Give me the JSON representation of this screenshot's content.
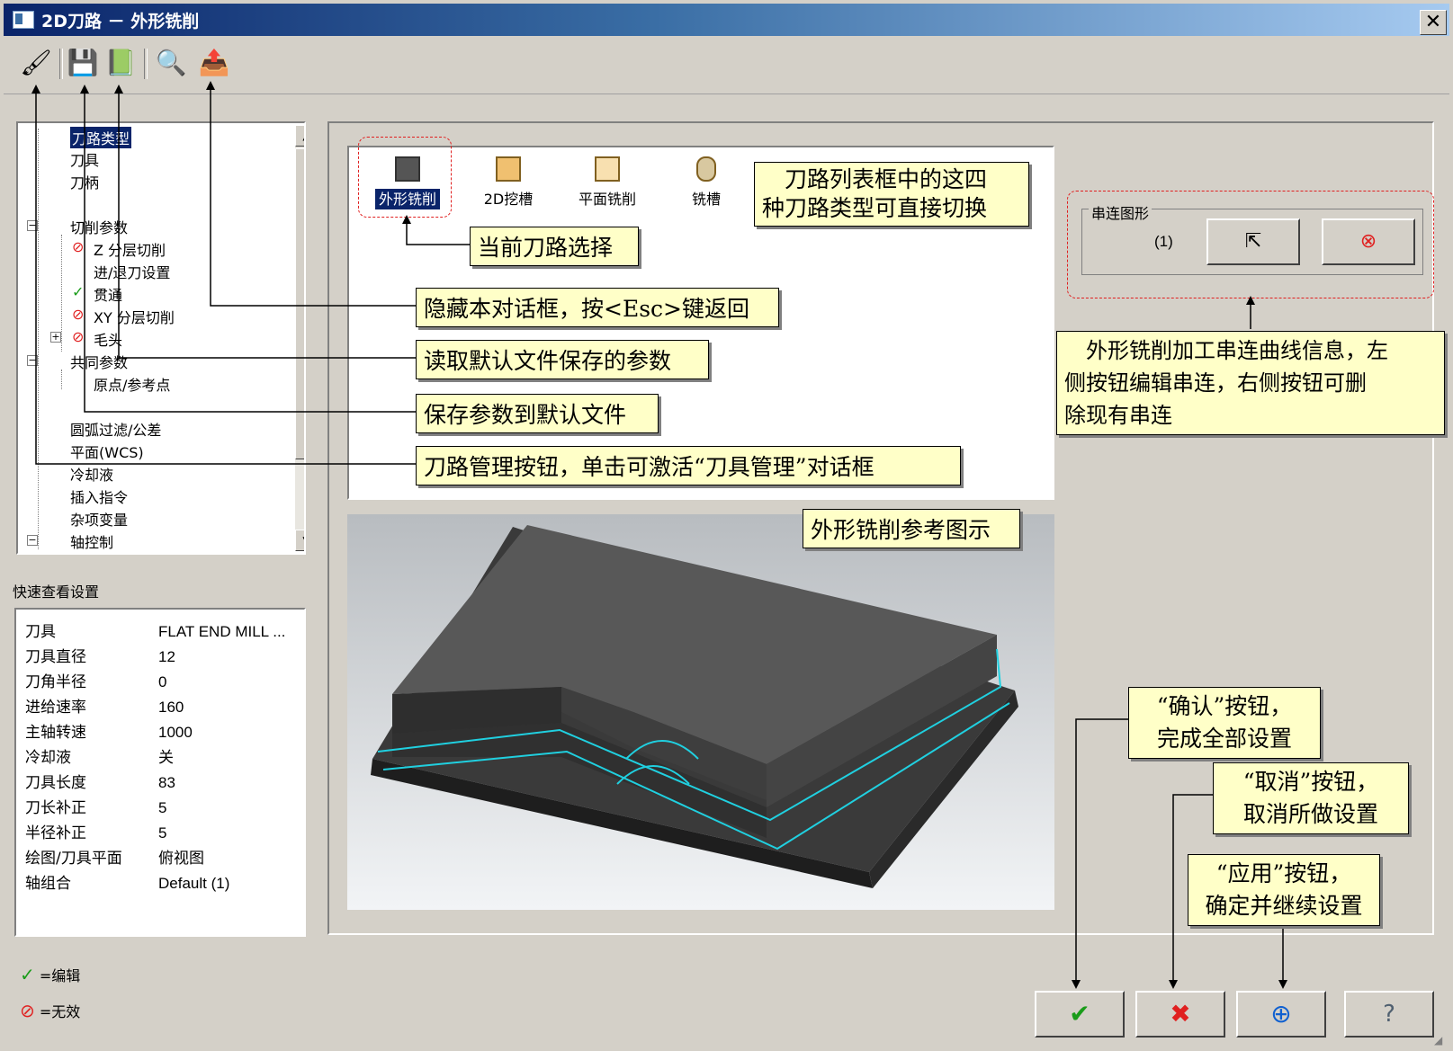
{
  "window": {
    "title": "2D刀路 － 外形铣削",
    "close_label": "✕"
  },
  "toolbar": [
    {
      "name": "tool-manager-button",
      "glyph": "🖌"
    },
    {
      "name": "save-default-button",
      "glyph": "💾"
    },
    {
      "name": "load-default-button",
      "glyph": "📗"
    },
    {
      "name": "preview-button",
      "glyph": "🔍"
    },
    {
      "name": "hide-dialog-button",
      "glyph": "📤"
    }
  ],
  "tree": {
    "items": [
      {
        "label": "刀路类型",
        "selected": true
      },
      {
        "label": "刀具"
      },
      {
        "label": "刀柄"
      },
      {
        "label": "切削参数"
      },
      {
        "label": "Z 分层切削",
        "status": "disabled"
      },
      {
        "label": "进/退刀设置"
      },
      {
        "label": "贯通",
        "status": "edited"
      },
      {
        "label": "XY 分层切削",
        "status": "disabled"
      },
      {
        "label": "毛头",
        "status": "disabled"
      },
      {
        "label": "共同参数"
      },
      {
        "label": "原点/参考点"
      },
      {
        "label": "圆弧过滤/公差"
      },
      {
        "label": "平面(WCS)"
      },
      {
        "label": "冷却液"
      },
      {
        "label": "插入指令"
      },
      {
        "label": "杂项变量"
      },
      {
        "label": "轴控制"
      }
    ]
  },
  "quick_view": {
    "label": "快速查看设置",
    "rows": [
      {
        "key": "刀具",
        "value": "FLAT END MILL ..."
      },
      {
        "key": "刀具直径",
        "value": "12"
      },
      {
        "key": "刀角半径",
        "value": "0"
      },
      {
        "key": "进给速率",
        "value": "160"
      },
      {
        "key": "主轴转速",
        "value": "1000"
      },
      {
        "key": "冷却液",
        "value": "关"
      },
      {
        "key": "刀具长度",
        "value": "83"
      },
      {
        "key": "刀长补正",
        "value": "5"
      },
      {
        "key": "半径补正",
        "value": "5"
      },
      {
        "key": "绘图/刀具平面",
        "value": "俯视图"
      },
      {
        "key": "轴组合",
        "value": "Default (1)"
      }
    ]
  },
  "legend": {
    "edited": "=编辑",
    "disabled": "=无效"
  },
  "path_types": [
    {
      "label": "外形铣削",
      "selected": true
    },
    {
      "label": "2D挖槽"
    },
    {
      "label": "平面铣削"
    },
    {
      "label": "铣槽"
    }
  ],
  "chain": {
    "title": "串连图形",
    "count": "(1)"
  },
  "annotations": {
    "switch_types_1": "刀路列表框中的这四",
    "switch_types_2": "种刀路类型可直接切换",
    "current_path": "当前刀路选择",
    "hide_dialog": "隐藏本对话框，按<Esc>键返回",
    "read_default": "读取默认文件保存的参数",
    "save_default": "保存参数到默认文件",
    "tool_manager": "刀路管理按钮，单击可激活“刀具管理”对话框",
    "chain_info_1": "外形铣削加工串连曲线信息，左",
    "chain_info_2": "侧按钮编辑串连，右侧按钮可删",
    "chain_info_3": "除现有串连",
    "preview_ref": "外形铣削参考图示",
    "ok_1": "“确认”按钮，",
    "ok_2": "完成全部设置",
    "cancel_1": "“取消”按钮，",
    "cancel_2": "取消所做设置",
    "apply_1": "“应用”按钮，",
    "apply_2": "确定并继续设置"
  },
  "colors": {
    "ok": "#1a9c1a",
    "cancel": "#e02020",
    "apply": "#1060d0",
    "note_bg": "#ffffc8"
  }
}
